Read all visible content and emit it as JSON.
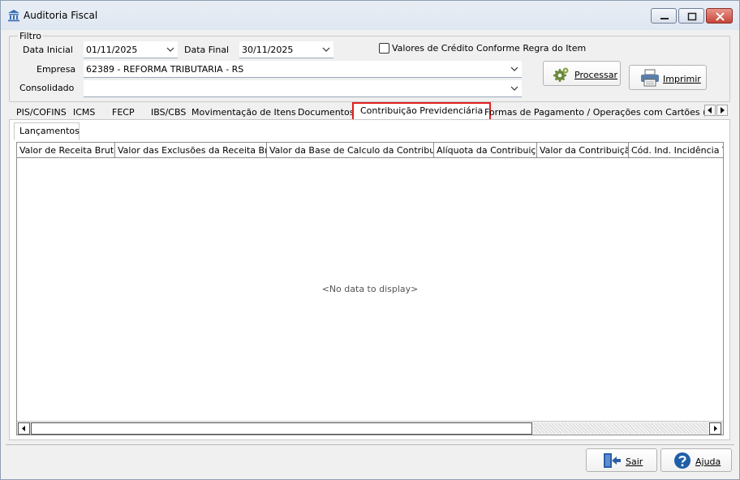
{
  "window": {
    "title": "Auditoria Fiscal"
  },
  "filter": {
    "title": "Filtro",
    "data_inicial_label": "Data Inicial",
    "data_inicial_value": "01/11/2025",
    "data_final_label": "Data Final",
    "data_final_value": "30/11/2025",
    "checkbox_label": "Valores de Crédito Conforme Regra do Item",
    "checkbox_checked": false,
    "empresa_label": "Empresa",
    "empresa_value": "62389 - REFORMA TRIBUTARIA - RS",
    "consolidado_label": "Consolidado",
    "consolidado_value": ""
  },
  "buttons": {
    "processar": "Processar",
    "imprimir": "Imprimir",
    "sair": "Sair",
    "ajuda": "Ajuda"
  },
  "tabs": [
    {
      "label": "PIS/COFINS"
    },
    {
      "label": "ICMS"
    },
    {
      "label": "FECP"
    },
    {
      "label": "IBS/CBS"
    },
    {
      "label": "Movimentação de Itens"
    },
    {
      "label": "Documentos"
    },
    {
      "label": "Contribuição Previdenciária",
      "active": true
    },
    {
      "label": "Formas de Pagamento / Operações com Cartões  (Re"
    }
  ],
  "subtabs": [
    {
      "label": "Lançamentos"
    }
  ],
  "grid": {
    "columns": [
      "Valor de Receita Bruta",
      "Valor das Exclusões da Receita Bruta",
      "Valor da Base de Calculo da Contribuição",
      "Alíquota da Contribuição",
      "Valor da Contribuição",
      "Cód. Ind. Incidência Trib"
    ],
    "empty_text": "<No data to display>"
  },
  "colors": {
    "active_tab_border": "#e02020"
  },
  "icons": {
    "app": "building-icon",
    "processar": "gears-icon",
    "imprimir": "printer-icon",
    "sair": "exit-door-icon",
    "ajuda": "help-icon"
  }
}
